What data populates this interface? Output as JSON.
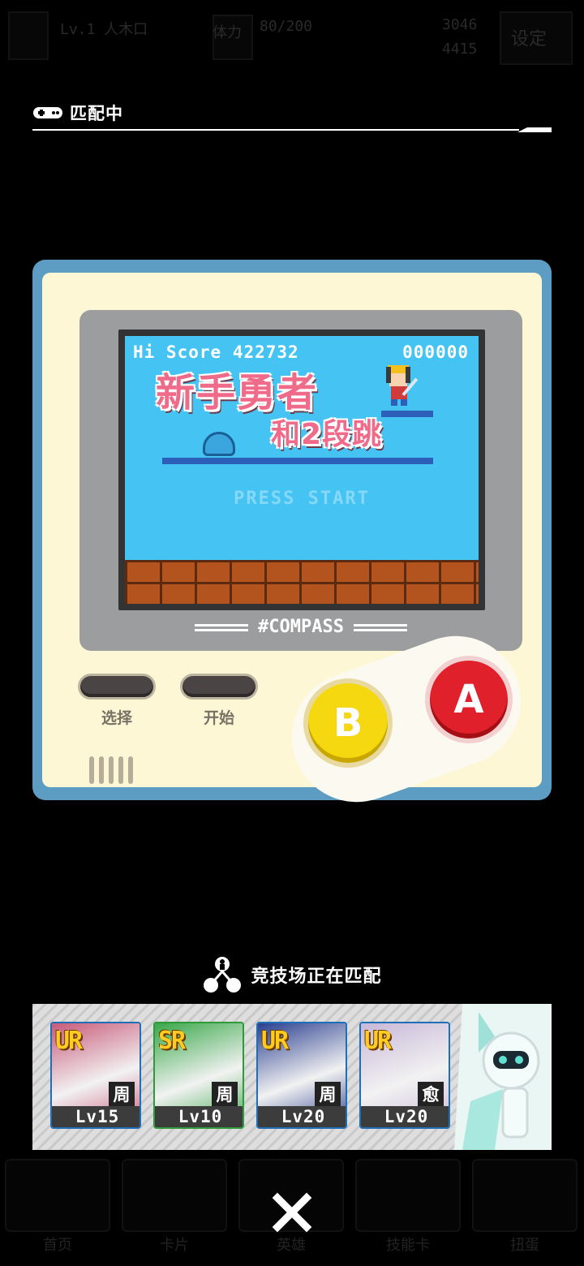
{
  "top_bar": {
    "player_name_partial": "Lv.1 人木口",
    "stamina_label": "体力",
    "stamina_value": "80/200",
    "coins_1": "3046",
    "coins_2": "4415",
    "settings_label": "设定"
  },
  "header": {
    "title": "匹配中"
  },
  "game_screen": {
    "hi_score_label": "Hi Score",
    "hi_score_value": "422732",
    "score": "000000",
    "title_line1": "新手勇者",
    "title_line2": "和2段跳",
    "press_start": "PRESS START",
    "brand": "#COMPASS"
  },
  "console_buttons": {
    "select_label": "选择",
    "start_label": "开始",
    "b_label": "B",
    "a_label": "A"
  },
  "arena": {
    "status": "竞技场正在匹配"
  },
  "deck": {
    "cards": [
      {
        "rarity": "UR",
        "role": "周",
        "level": "Lv15",
        "color": "#c85a7a"
      },
      {
        "rarity": "SR",
        "role": "周",
        "level": "Lv10",
        "color": "#39a84a"
      },
      {
        "rarity": "UR",
        "role": "周",
        "level": "Lv20",
        "color": "#2a3f8f"
      },
      {
        "rarity": "UR",
        "role": "愈",
        "level": "Lv20",
        "color": "#c8b8d8"
      }
    ]
  },
  "bottom_nav": {
    "items": [
      "首页",
      "卡片",
      "英雄",
      "技能卡",
      "扭蛋"
    ]
  },
  "colors": {
    "console_blue": "#5d9dc4",
    "console_cream": "#fdf7d6",
    "screen_sky": "#45c4f4",
    "button_a_red": "#e0202a",
    "button_b_yellow": "#f5d810"
  }
}
